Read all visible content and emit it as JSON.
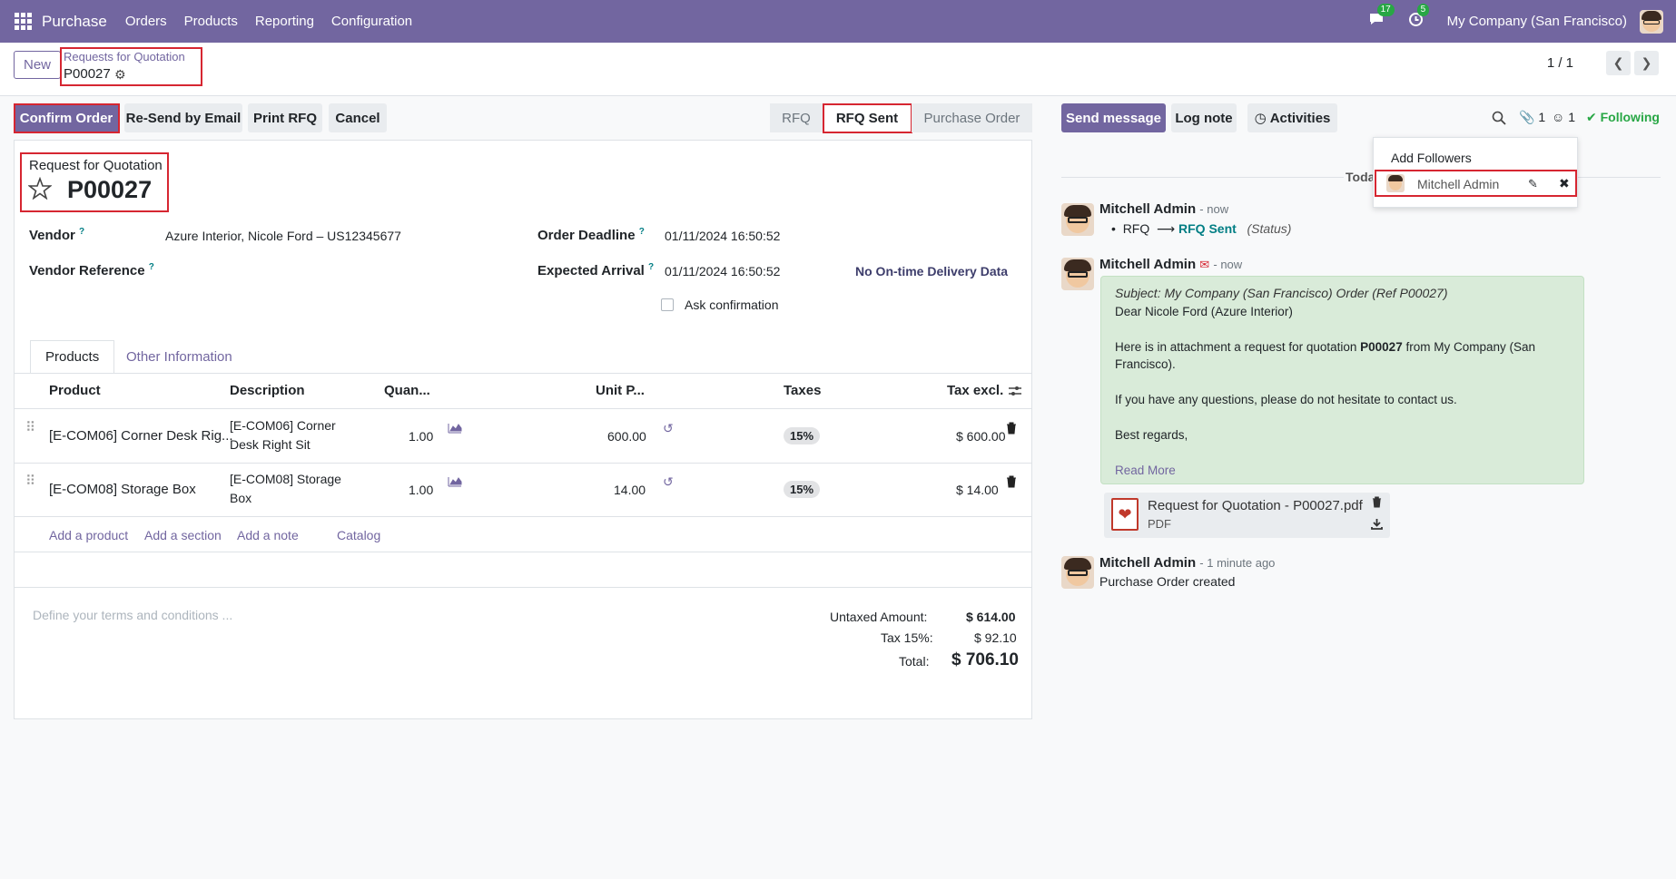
{
  "navbar": {
    "app_name": "Purchase",
    "menu": [
      "Orders",
      "Products",
      "Reporting",
      "Configuration"
    ],
    "messages_count": "17",
    "activities_count": "5",
    "company": "My Company (San Francisco)"
  },
  "control_panel": {
    "new_label": "New",
    "breadcrumb_parent": "Requests for Quotation",
    "breadcrumb_current": "P00027",
    "pager": "1 / 1"
  },
  "actions": {
    "confirm": "Confirm Order",
    "resend": "Re-Send by Email",
    "print": "Print RFQ",
    "cancel": "Cancel"
  },
  "statusbar": [
    "RFQ",
    "RFQ Sent",
    "Purchase Order"
  ],
  "form": {
    "doc_type": "Request for Quotation",
    "doc_name": "P00027",
    "vendor_label": "Vendor",
    "vendor_value": "Azure Interior, Nicole Ford – US12345677",
    "vendor_ref_label": "Vendor Reference",
    "order_deadline_label": "Order Deadline",
    "order_deadline_value": "01/11/2024 16:50:52",
    "expected_arrival_label": "Expected Arrival",
    "expected_arrival_value": "01/11/2024 16:50:52",
    "delivery_data": "No On-time Delivery Data",
    "ask_confirmation": "Ask confirmation",
    "tabs": [
      "Products",
      "Other Information"
    ]
  },
  "lines": {
    "headers": [
      "Product",
      "Description",
      "Quan...",
      "Unit P...",
      "Taxes",
      "Tax excl."
    ],
    "rows": [
      {
        "product": "[E-COM06] Corner Desk Rig...",
        "desc1": "[E-COM06] Corner",
        "desc2": "Desk Right Sit",
        "qty": "1.00",
        "price": "600.00",
        "tax": "15%",
        "subtotal": "$ 600.00"
      },
      {
        "product": "[E-COM08] Storage Box",
        "desc1": "[E-COM08] Storage",
        "desc2": "Box",
        "qty": "1.00",
        "price": "14.00",
        "tax": "15%",
        "subtotal": "$ 14.00"
      }
    ],
    "add_product": "Add a product",
    "add_section": "Add a section",
    "add_note": "Add a note",
    "catalog": "Catalog"
  },
  "terms_placeholder": "Define your terms and conditions ...",
  "totals": {
    "untaxed_label": "Untaxed Amount:",
    "untaxed_value": "$ 614.00",
    "tax_label": "Tax 15%:",
    "tax_value": "$ 92.10",
    "total_label": "Total:",
    "total_value": "$ 706.10"
  },
  "chatter": {
    "send_message": "Send message",
    "log_note": "Log note",
    "activities": "Activities",
    "attachments_count": "1",
    "followers_count": "1",
    "following": "Following",
    "today": "Toda",
    "add_followers": "Add Followers",
    "follower_name": "Mitchell Admin",
    "messages": [
      {
        "author": "Mitchell Admin",
        "time": "- now",
        "tracking_old": "RFQ",
        "tracking_new": "RFQ Sent",
        "tracking_field": "(Status)"
      },
      {
        "author": "Mitchell Admin",
        "time": "- now",
        "subject": "Subject: My Company (San Francisco) Order (Ref P00027)",
        "greeting": "Dear Nicole Ford (Azure Interior)",
        "body1_pre": "Here is in attachment a request for quotation ",
        "body1_ref": "P00027",
        "body1_post": " from My Company (San",
        "body1_line2": "Francisco).",
        "body2": "If you have any questions, please do not hesitate to contact us.",
        "body3": "Best regards,",
        "read_more": "Read More",
        "attachment_name": "Request for Quotation - P00027.pdf",
        "attachment_type": "PDF"
      },
      {
        "author": "Mitchell Admin",
        "time": "- 1 minute ago",
        "body": "Purchase Order created"
      }
    ]
  },
  "colors": {
    "brand": "#7266a0",
    "highlight": "#d62631",
    "success": "#28a745",
    "link_teal": "#017e84"
  }
}
